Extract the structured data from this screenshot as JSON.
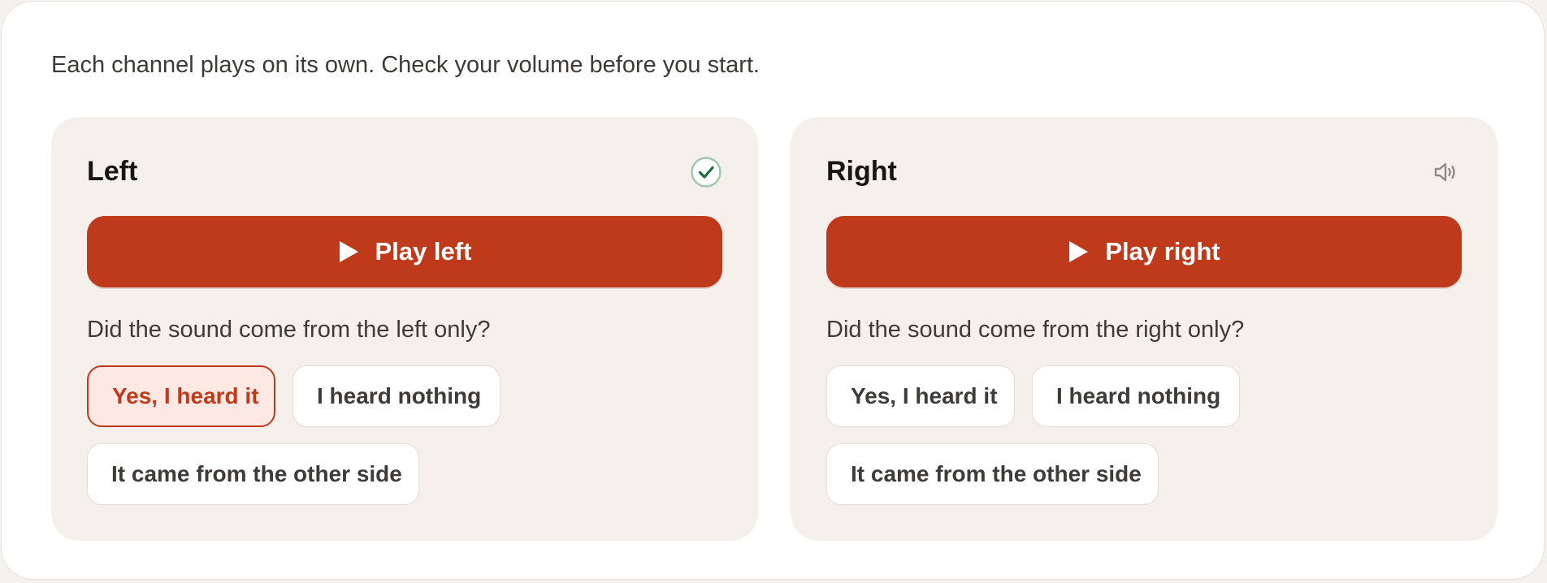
{
  "intro": "Each channel plays on its own. Check your volume before you start.",
  "colors": {
    "accent": "#bf3a1b",
    "panel_bg": "#f5f0ec",
    "selected_bg": "#fde9e3",
    "check": "#1f6b3a"
  },
  "channels": [
    {
      "title": "Left",
      "status_icon": "check-circle-icon",
      "play_label": "Play left",
      "question": "Did the sound come from the left only?",
      "options": [
        "Yes, I heard it",
        "I heard nothing",
        "It came from the other side"
      ],
      "selected_option": "Yes, I heard it"
    },
    {
      "title": "Right",
      "status_icon": "speaker-icon",
      "play_label": "Play right",
      "question": "Did the sound come from the right only?",
      "options": [
        "Yes, I heard it",
        "I heard nothing",
        "It came from the other side"
      ],
      "selected_option": null
    }
  ]
}
